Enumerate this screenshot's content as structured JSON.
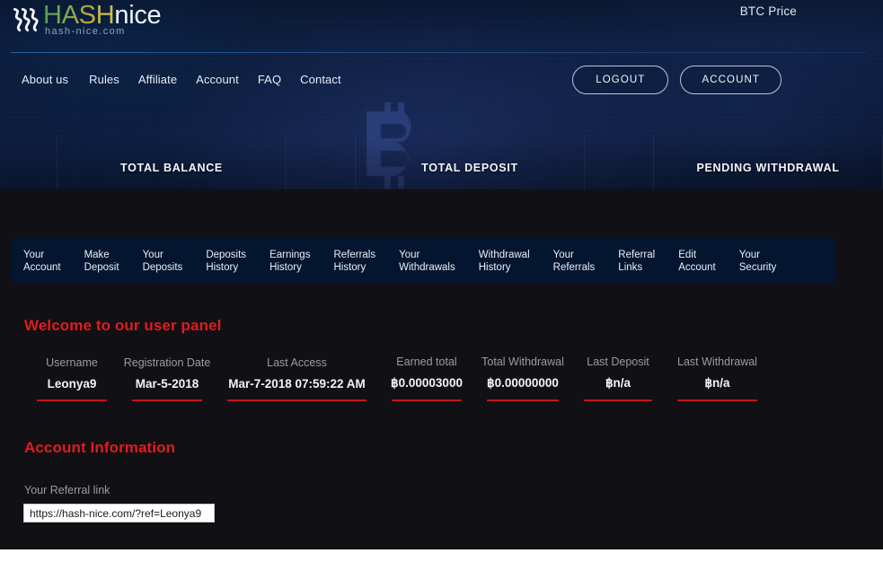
{
  "brand": {
    "logo_hash": "HASH",
    "logo_nice": "nice",
    "logo_sub": "hash-nice.com",
    "logo_icon": "waves-logo-icon"
  },
  "header": {
    "btc_price_label": "BTC Price",
    "nav": [
      {
        "label": "About us"
      },
      {
        "label": "Rules"
      },
      {
        "label": "Affiliate"
      },
      {
        "label": "Account"
      },
      {
        "label": "FAQ"
      },
      {
        "label": "Contact"
      }
    ],
    "logout_button": "LOGOUT",
    "account_button": "ACCOUNT"
  },
  "hero_cards": [
    {
      "title": "TOTAL BALANCE",
      "value": ""
    },
    {
      "title": "TOTAL DEPOSIT",
      "value": ""
    },
    {
      "title": "PENDING WITHDRAWAL",
      "value": ""
    }
  ],
  "tabs": [
    {
      "line1": "Your",
      "line2": "Account"
    },
    {
      "line1": "Make",
      "line2": "Deposit"
    },
    {
      "line1": "Your",
      "line2": "Deposits"
    },
    {
      "line1": "Deposits",
      "line2": "History"
    },
    {
      "line1": "Earnings",
      "line2": "History"
    },
    {
      "line1": "Referrals",
      "line2": "History"
    },
    {
      "line1": "Your",
      "line2": "Withdrawals"
    },
    {
      "line1": "Withdrawal",
      "line2": "History"
    },
    {
      "line1": "Your",
      "line2": "Referrals"
    },
    {
      "line1": "Referral",
      "line2": "Links"
    },
    {
      "line1": "Edit",
      "line2": "Account"
    },
    {
      "line1": "Your",
      "line2": "Security"
    }
  ],
  "main": {
    "welcome_title": "Welcome to our user panel",
    "account_info_title": "Account Information",
    "stats": [
      {
        "label": "Username",
        "value": "Leonya9"
      },
      {
        "label": "Registration Date",
        "value": "Mar-5-2018"
      },
      {
        "label": "Last Access",
        "value": "Mar-7-2018 07:59:22 AM"
      },
      {
        "label": "Earned total",
        "value": "฿0.00003000"
      },
      {
        "label": "Total Withdrawal",
        "value": "฿0.00000000"
      },
      {
        "label": "Last Deposit",
        "value": "฿n/a"
      },
      {
        "label": "Last Withdrawal",
        "value": "฿n/a"
      }
    ],
    "referral_link_label": "Your Referral link",
    "referral_link_value": "https://hash-nice.com/?ref=Leonya9",
    "referral_link_placeholder": "https://hash-nice.com/?ref="
  },
  "colors": {
    "accent_red": "#e01c1c",
    "underline_red": "#c0161a",
    "page_bg": "#111015",
    "tabbar_bg": "#04152f",
    "hero_blue": "#0b1c3c",
    "logo_green": "#4f9c5a",
    "logo_gold": "#cfc04e"
  }
}
